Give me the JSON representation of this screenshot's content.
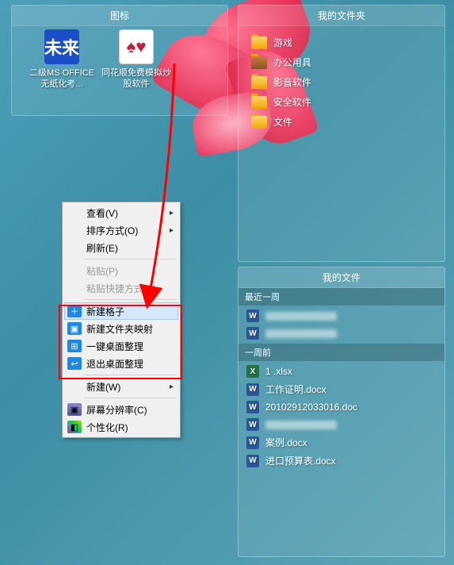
{
  "fences": {
    "icons": {
      "title": "图标",
      "items": [
        {
          "label": "二级MS OFFICE无纸化考...",
          "glyph": "未来"
        },
        {
          "label": "同花顺免费模拟炒股软件",
          "glyph": "♠♥"
        }
      ]
    },
    "folders": {
      "title": "我的文件夹",
      "items": [
        {
          "label": "游戏",
          "type": "folder"
        },
        {
          "label": "办公用具",
          "type": "briefcase"
        },
        {
          "label": "影音软件",
          "type": "folder"
        },
        {
          "label": "安全软件",
          "type": "folder"
        },
        {
          "label": "文件",
          "type": "folder"
        }
      ]
    },
    "files": {
      "title": "我的文件",
      "sections": [
        {
          "header": "最近一周",
          "items": [
            {
              "label": "",
              "type": "doc",
              "blurred": true
            },
            {
              "label": "",
              "type": "doc",
              "blurred": true
            }
          ]
        },
        {
          "header": "一周前",
          "items": [
            {
              "label": "1 .xlsx",
              "type": "xls"
            },
            {
              "label": "工作证明.docx",
              "type": "doc"
            },
            {
              "label": "20102912033016.doc",
              "type": "doc"
            },
            {
              "label": "",
              "type": "doc",
              "blurred": true
            },
            {
              "label": "案例.docx",
              "type": "doc"
            },
            {
              "label": "进口预算表.docx",
              "type": "doc"
            }
          ]
        }
      ]
    }
  },
  "context_menu": {
    "items": [
      {
        "label": "查看(V)",
        "submenu": true
      },
      {
        "label": "排序方式(O)",
        "submenu": true
      },
      {
        "label": "刷新(E)"
      },
      {
        "sep": true
      },
      {
        "label": "粘贴(P)",
        "disabled": true
      },
      {
        "label": "粘贴快捷方式(S)",
        "disabled": true
      },
      {
        "sep": true
      },
      {
        "label": "新建格子",
        "icon": "plus",
        "hover": true,
        "fencer": true
      },
      {
        "label": "新建文件夹映射",
        "icon": "map",
        "fencer": true
      },
      {
        "label": "一键桌面整理",
        "icon": "grid",
        "fencer": true
      },
      {
        "label": "退出桌面整理",
        "icon": "exit",
        "fencer": true
      },
      {
        "sep": true
      },
      {
        "label": "新建(W)",
        "submenu": true
      },
      {
        "sep": true
      },
      {
        "label": "屏幕分辨率(C)",
        "icon": "screen"
      },
      {
        "label": "个性化(R)",
        "icon": "personal"
      }
    ],
    "icon_glyphs": {
      "plus": "＋",
      "map": "▣",
      "grid": "⊞",
      "exit": "↩",
      "screen": "▣",
      "personal": "◧"
    }
  }
}
